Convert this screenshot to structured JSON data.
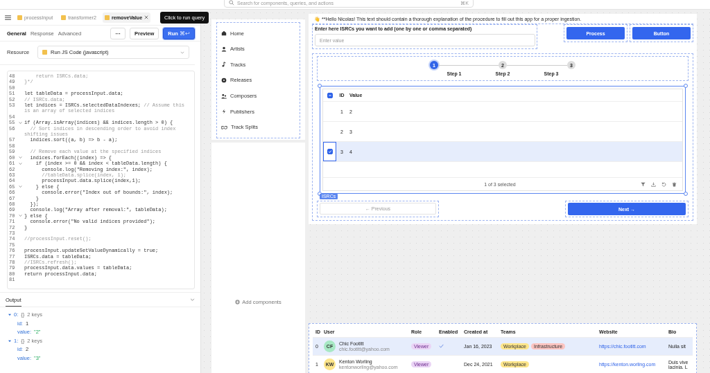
{
  "search": {
    "placeholder": "Search for components, queries, and actions",
    "shortcut": "⌘K"
  },
  "query_tabs": [
    {
      "label": "processInput",
      "selected": false,
      "closable": false
    },
    {
      "label": "transformer2",
      "selected": false,
      "closable": false
    },
    {
      "label": "removeValue",
      "selected": true,
      "closable": true
    }
  ],
  "tooltip": "Click to run query",
  "sub_tabs": [
    {
      "label": "General",
      "selected": true
    },
    {
      "label": "Response",
      "selected": false
    },
    {
      "label": "Advanced",
      "selected": false
    }
  ],
  "toolbar": {
    "more": "···",
    "preview": "Preview",
    "run": "Run",
    "run_shortcut": "⌘↩"
  },
  "resource": {
    "label": "Resource",
    "value": "Run JS Code (javascript)"
  },
  "code": [
    {
      "num": "48",
      "comment": "    return ISRCs.data;",
      "fold": false
    },
    {
      "num": "49",
      "comment": "}*/",
      "fold": false
    },
    {
      "num": "50",
      "fold": false
    },
    {
      "num": "51",
      "code": "let tableData = processInput.data;",
      "fold": false
    },
    {
      "num": "52",
      "comment": "// ISRCs.data;",
      "fold": false
    },
    {
      "num": "53",
      "code": "let indices = ISRCs.selectedDataIndexes; ",
      "comment": "// Assume this is an array of selected indices",
      "fold": false
    },
    {
      "num": "54",
      "fold": false
    },
    {
      "num": "55",
      "code": "if (Array.isArray(indices) && indices.length > 0) {",
      "fold": true
    },
    {
      "num": "56",
      "comment": "  // Sort indices in descending order to avoid index shifting issues",
      "fold": false
    },
    {
      "num": "57",
      "code": "  indices.sort((a, b) => b - a);",
      "fold": false
    },
    {
      "num": "58",
      "fold": false
    },
    {
      "num": "59",
      "comment": "  // Remove each value at the specified indices",
      "fold": false
    },
    {
      "num": "60",
      "code": "  indices.forEach((index) => {",
      "fold": true
    },
    {
      "num": "61",
      "code": "    if (index >= 0 && index < tableData.length) {",
      "fold": true
    },
    {
      "num": "62",
      "code": "      console.log(\"Removing index:\", index);",
      "fold": false
    },
    {
      "num": "63",
      "comment": "      //tableData.splice(index, 1);",
      "fold": false
    },
    {
      "num": "64",
      "code": "      processInput.data.splice(index,1);",
      "fold": false
    },
    {
      "num": "65",
      "code": "    } else {",
      "fold": true
    },
    {
      "num": "66",
      "code": "      console.error(\"Index out of bounds:\", index);",
      "fold": false
    },
    {
      "num": "67",
      "code": "    }",
      "fold": false
    },
    {
      "num": "68",
      "code": "  });",
      "fold": false
    },
    {
      "num": "69",
      "code": "  console.log(\"Array after removal:\", tableData);",
      "fold": false
    },
    {
      "num": "70",
      "code": "} else {",
      "fold": true
    },
    {
      "num": "71",
      "code": "  console.error(\"No valid indices provided\");",
      "fold": false
    },
    {
      "num": "72",
      "code": "}",
      "fold": false
    },
    {
      "num": "73",
      "fold": false
    },
    {
      "num": "74",
      "comment": "//processInput.reset();",
      "fold": false
    },
    {
      "num": "75",
      "fold": false
    },
    {
      "num": "76",
      "code": "processInput.updateSetValueDynamically = true;",
      "fold": false
    },
    {
      "num": "77",
      "code": "ISRCs.data = tableData;",
      "fold": false
    },
    {
      "num": "78",
      "comment": "//ISRCs.refresh();",
      "fold": false
    },
    {
      "num": "79",
      "code": "processInput.data.values = tableData;",
      "fold": false
    },
    {
      "num": "80",
      "code": "return processInput.data;",
      "fold": false
    },
    {
      "num": "81",
      "fold": false
    }
  ],
  "output": {
    "title": "Output",
    "nodes": [
      {
        "key": "0:",
        "type": "{}",
        "summary": "2 keys",
        "expanded": true,
        "children": [
          {
            "key": "id:",
            "value": "1",
            "kind": "number"
          },
          {
            "key": "value:",
            "value": "\"2\"",
            "kind": "string"
          }
        ]
      },
      {
        "key": "1:",
        "type": "{}",
        "summary": "2 keys",
        "expanded": true,
        "children": [
          {
            "key": "id:",
            "value": "2",
            "kind": "number"
          },
          {
            "key": "value:",
            "value": "\"3\"",
            "kind": "string"
          }
        ]
      }
    ]
  },
  "nav": [
    {
      "label": "Home"
    },
    {
      "label": "Artists"
    },
    {
      "label": "Tracks"
    },
    {
      "label": "Releases"
    },
    {
      "label": "Composers"
    },
    {
      "label": "Publishers"
    },
    {
      "label": "Track Splits"
    }
  ],
  "add_components": "Add components",
  "intro": "👋 **Hello Nicolas! This text should contain a thorough explanation of the procedure to fill out this app for a proper ingestion.",
  "isrc_input": {
    "label": "Enter here ISRCs you want to add (one by one or comma separated)",
    "placeholder": "Enter value"
  },
  "buttons": [
    "Process",
    "Button"
  ],
  "steps": [
    {
      "num": "1",
      "label": "Step 1",
      "selected": true
    },
    {
      "num": "2",
      "label": "Step 2",
      "selected": false
    },
    {
      "num": "3",
      "label": "Step 3",
      "selected": false
    }
  ],
  "isrc_table": {
    "select_all": {
      "indeterminate": true
    },
    "columns": [
      "ID",
      "Value"
    ],
    "rows": [
      {
        "id": "1",
        "value": "2",
        "selected": false
      },
      {
        "id": "2",
        "value": "3",
        "selected": false
      },
      {
        "id": "3",
        "value": "4",
        "selected": true
      }
    ],
    "footer": "1 of 3 selected",
    "tag": "ISRCs"
  },
  "pager": {
    "previous": "← Previous",
    "next": "Next →"
  },
  "users_table": {
    "columns": [
      "ID",
      "User",
      "Role",
      "Enabled",
      "Created at",
      "Teams",
      "Website",
      "Bio"
    ],
    "rows": [
      {
        "id": "0",
        "initials": "CF",
        "color": "#a7e8c4",
        "name": "Chic Footitt",
        "email": "chic.footitt@yahoo.com",
        "role": "Viewer",
        "enabled": true,
        "created": "Jan 16, 2023",
        "teams": [
          {
            "label": "Workplace",
            "color": "#fde58a"
          },
          {
            "label": "Infrastructure",
            "color": "#fcc4c0"
          }
        ],
        "website": "https://chic.footitt.com",
        "bio": [
          "Nulla sit"
        ],
        "selected": true
      },
      {
        "id": "1",
        "initials": "KW",
        "color": "#fde58a",
        "name": "Kenton Worling",
        "email": "kentonworling@yahoo.com",
        "role": "Viewer",
        "enabled": false,
        "created": "Dec 24, 2021",
        "teams": [
          {
            "label": "Workplace",
            "color": "#fde58a"
          }
        ],
        "website": "https://kenton.worling.com",
        "bio": [
          "Duis vive",
          "lacinia. L"
        ],
        "selected": false
      }
    ]
  }
}
